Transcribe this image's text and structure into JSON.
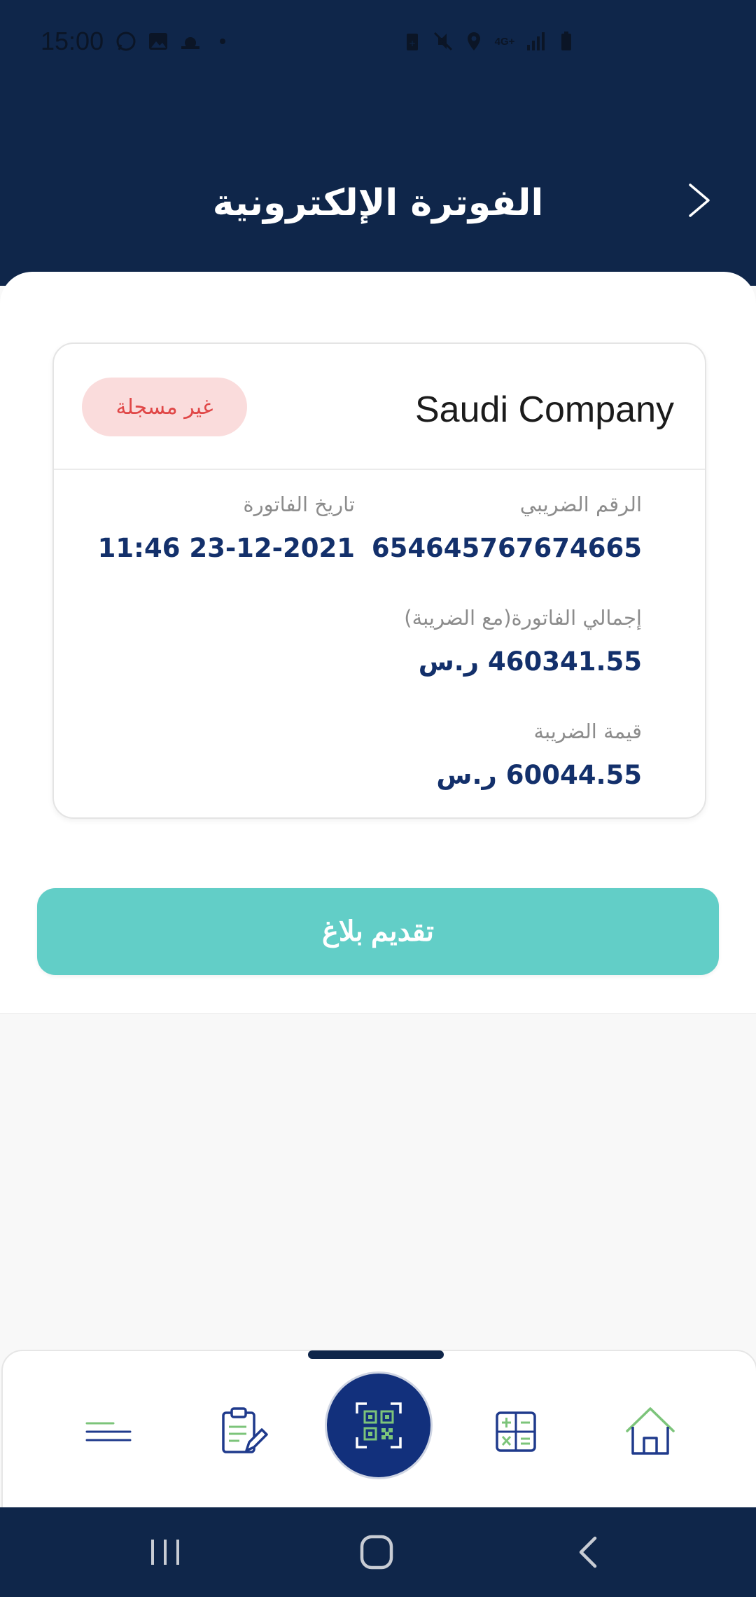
{
  "status_bar": {
    "time": "15:00",
    "left_icons": [
      "whatsapp-icon",
      "gallery-icon",
      "weather-icon",
      "dot-icon"
    ],
    "right_icons": [
      "battery-saver-icon",
      "mute-icon",
      "location-icon",
      "4g-icon",
      "signal-icon",
      "battery-icon"
    ],
    "network_label": "4G+"
  },
  "header": {
    "title": "الفوترة الإلكترونية",
    "back_icon": "chevron-right-icon"
  },
  "invoice": {
    "company": "Saudi Company",
    "status_badge": "غير مسجلة",
    "tax_number_label": "الرقم الضريبي",
    "tax_number": "654645767674665",
    "invoice_date_label": "تاريخ الفاتورة",
    "invoice_date": "11:46 23-12-2021",
    "total_label": "إجمالي الفاتورة(مع الضريبة)",
    "total_value": "460341.55 ر.س",
    "tax_value_label": "قيمة الضريبة",
    "tax_value": "60044.55 ر.س"
  },
  "action": {
    "submit_report_label": "تقديم بلاغ"
  },
  "bottom_nav": {
    "items": [
      {
        "icon": "menu-icon"
      },
      {
        "icon": "clipboard-edit-icon"
      },
      {
        "icon": "qr-scan-icon"
      },
      {
        "icon": "calculator-icon"
      },
      {
        "icon": "home-icon"
      }
    ]
  },
  "colors": {
    "primary_dark": "#0f264a",
    "accent_teal": "#62cec7",
    "value_blue": "#13306b",
    "badge_bg": "#fadcdc",
    "badge_text": "#e04747",
    "icon_green": "#7cc47a"
  }
}
